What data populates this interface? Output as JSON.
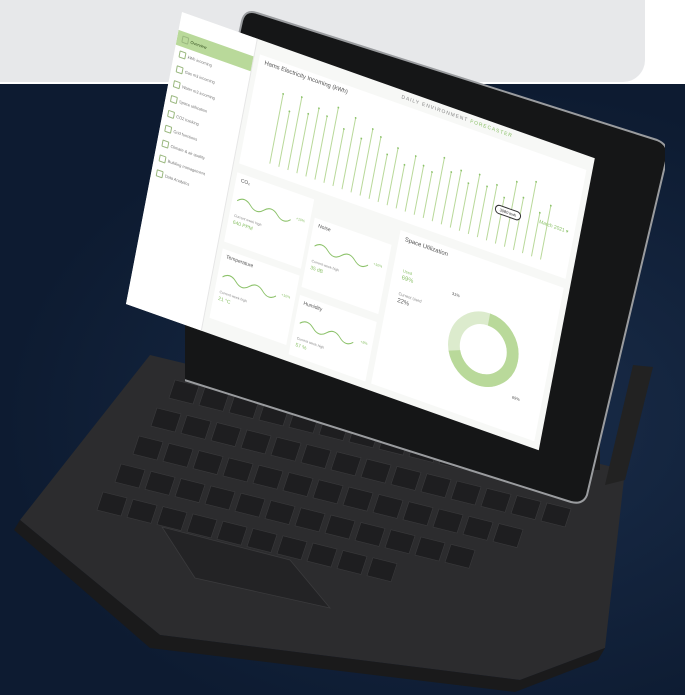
{
  "dashboard": {
    "brand_prefix": "DAILY ENVIRONMENT",
    "brand_suffix": "FORECASTER",
    "chart_title": "Hams Electricity Incoming (kWh)",
    "month_label": "March 2021 ▾",
    "bubble_value": "3080 kwh",
    "sidebar_items": [
      {
        "label": "Overview"
      },
      {
        "label": "kWh incoming"
      },
      {
        "label": "Gas m3 incoming"
      },
      {
        "label": "Water m3 incoming"
      },
      {
        "label": "Space utilization"
      },
      {
        "label": "CO2 tracking"
      },
      {
        "label": "Grid functions"
      },
      {
        "label": "Climate & air quality"
      },
      {
        "label": "Building management"
      },
      {
        "label": "Data Analytics"
      }
    ],
    "mini_cards": [
      {
        "title": "CO₂",
        "label": "Current week high",
        "value": "640 PPM",
        "change": "+10%"
      },
      {
        "title": "Noise",
        "label": "Current week high",
        "value": "35 dB",
        "change": "+10%"
      },
      {
        "title": "Temperature",
        "label": "Current week high",
        "value": "21 °C",
        "change": "+10%"
      },
      {
        "title": "Humidity",
        "label": "Current week high",
        "value": "57 %",
        "change": "+8%"
      }
    ],
    "space": {
      "title": "Space Utilization",
      "used_label": "Used",
      "used_value": "69%",
      "unused_label": "Current Used",
      "unused_value": "22%",
      "donut_label_a": "31%",
      "donut_label_b": "69%",
      "donut_fraction": 0.69
    },
    "bar_heights": [
      0.88,
      0.7,
      0.92,
      0.75,
      0.86,
      0.8,
      0.95,
      0.72,
      0.9,
      0.68,
      0.84,
      0.78,
      0.6,
      0.72,
      0.55,
      0.7,
      0.62,
      0.58,
      0.8,
      0.66,
      0.72,
      0.6,
      0.75,
      0.64,
      0.7,
      0.58,
      0.82,
      0.66,
      0.9,
      0.55,
      0.68
    ],
    "colors": {
      "accent": "#8cc26a",
      "accent_light": "#b9d99a",
      "background": "#0e1e36"
    }
  }
}
